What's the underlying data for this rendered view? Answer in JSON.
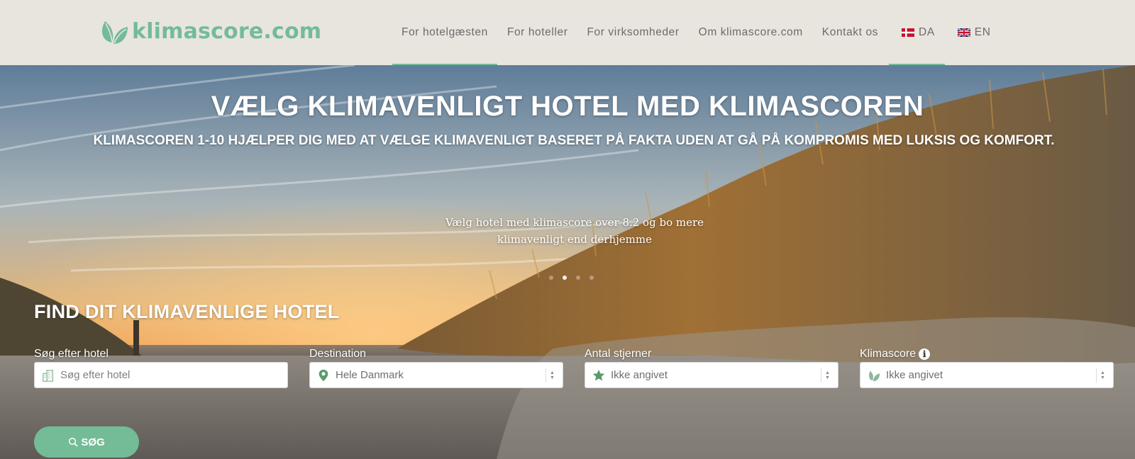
{
  "header": {
    "logo_text": "klimascore.com",
    "nav": [
      {
        "label": "For hotelgæsten",
        "active": true
      },
      {
        "label": "For hoteller",
        "active": false
      },
      {
        "label": "For virksomheder",
        "active": false
      },
      {
        "label": "Om klimascore.com",
        "active": false
      },
      {
        "label": "Kontakt os",
        "active": false
      }
    ],
    "languages": [
      {
        "code": "DA",
        "icon": "flag-denmark-icon",
        "active": true
      },
      {
        "code": "EN",
        "icon": "flag-uk-icon",
        "active": false
      }
    ]
  },
  "hero": {
    "title": "VÆLG KLIMAVENLIGT HOTEL MED KLIMASCOREN",
    "subtitle": "KLIMASCOREN 1-10 HJÆLPER DIG MED AT VÆLGE KLIMAVENLIGT BASERET PÅ FAKTA UDEN AT GÅ PÅ KOMPROMIS MED LUKSIS OG KOMFORT.",
    "slide_caption_line1": "Vælg hotel med klimascore over 8.2 og bo mere",
    "slide_caption_line2": "klimavenligt end derhjemme",
    "carousel": {
      "slides": 4,
      "active_index": 1
    }
  },
  "search": {
    "title": "FIND DIT KLIMAVENLIGE HOTEL",
    "hotel": {
      "label": "Søg efter hotel",
      "placeholder": "Søg efter hotel",
      "value": ""
    },
    "destination": {
      "label": "Destination",
      "value": "Hele Danmark"
    },
    "stars": {
      "label": "Antal stjerner",
      "value": "Ikke angivet"
    },
    "climate_score": {
      "label": "Klimascore",
      "info_icon": "i",
      "value": "Ikke angivet"
    },
    "button_label": "SØG"
  },
  "colors": {
    "brand_green": "#74bb98",
    "header_bg": "#e8e5de",
    "nav_text": "#6b6b6b"
  }
}
